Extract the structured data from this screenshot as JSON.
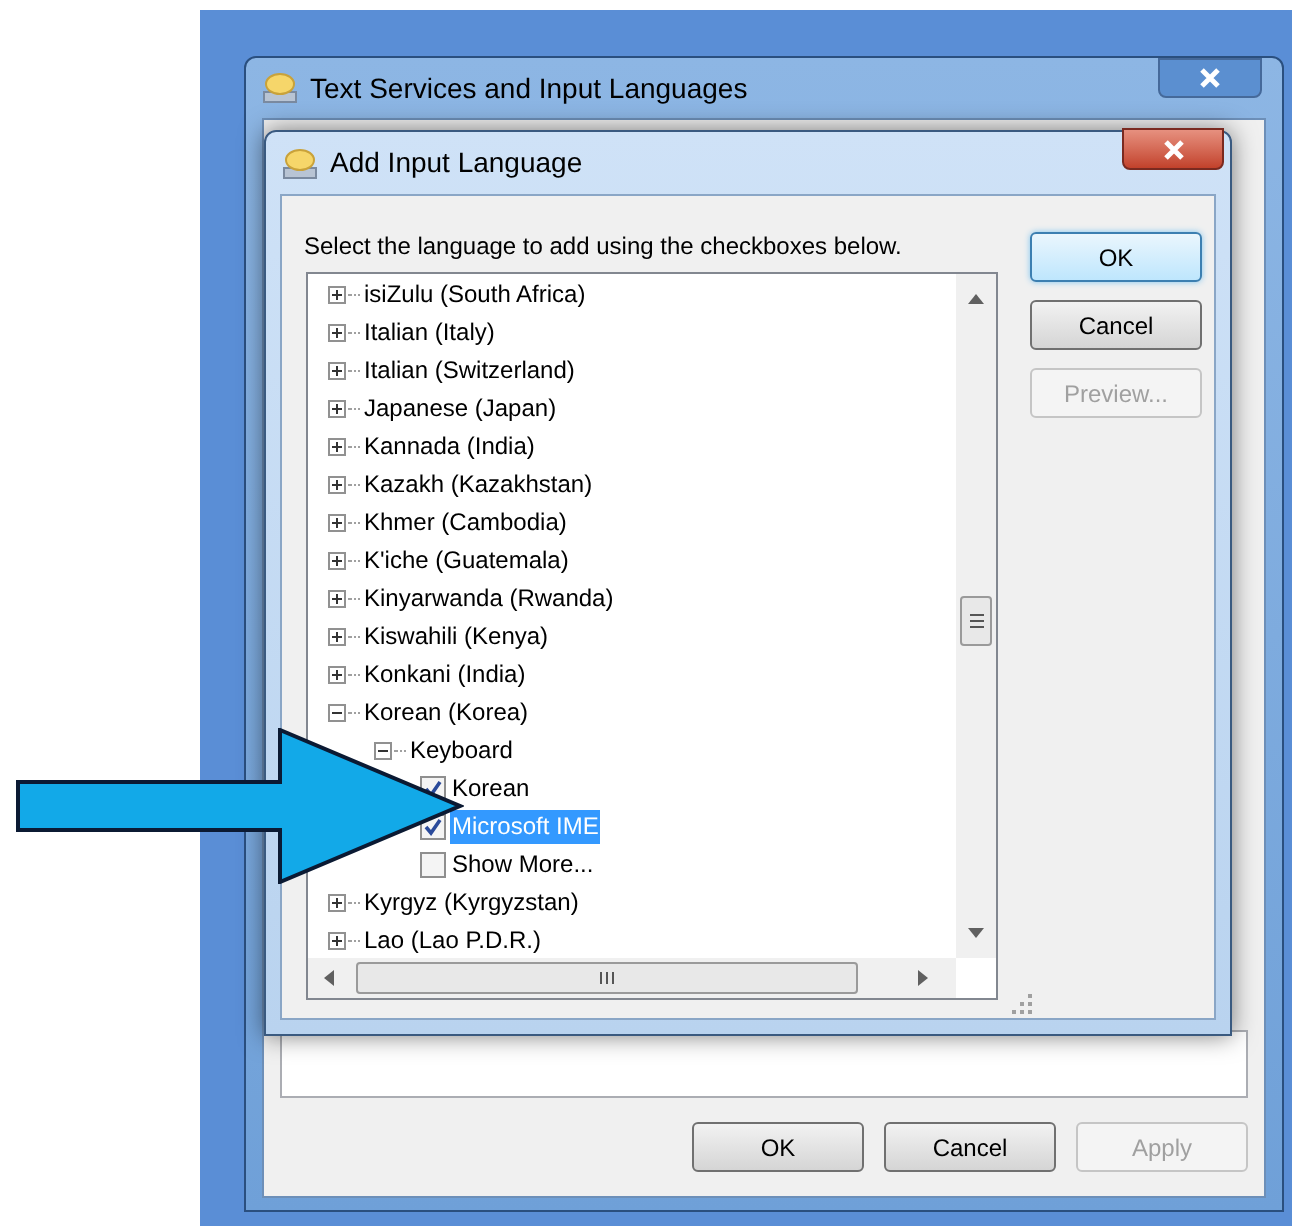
{
  "background_window": {
    "title": "Text Services and Input Languages",
    "buttons": [
      {
        "label": "OK",
        "disabled": false
      },
      {
        "label": "Cancel",
        "disabled": false
      },
      {
        "label": "Apply",
        "disabled": true
      }
    ]
  },
  "dialog": {
    "title": "Add Input Language",
    "instruction": "Select the language to add using the checkboxes below.",
    "tree": [
      {
        "label": "isiZulu (South Africa)",
        "expanded": false,
        "selected": false
      },
      {
        "label": "Italian (Italy)",
        "expanded": false,
        "selected": false
      },
      {
        "label": "Italian (Switzerland)",
        "expanded": false,
        "selected": false
      },
      {
        "label": "Japanese (Japan)",
        "expanded": false,
        "selected": false
      },
      {
        "label": "Kannada (India)",
        "expanded": false,
        "selected": false
      },
      {
        "label": "Kazakh (Kazakhstan)",
        "expanded": false,
        "selected": false
      },
      {
        "label": "Khmer (Cambodia)",
        "expanded": false,
        "selected": false
      },
      {
        "label": "K'iche (Guatemala)",
        "expanded": false,
        "selected": false
      },
      {
        "label": "Kinyarwanda (Rwanda)",
        "expanded": false,
        "selected": false
      },
      {
        "label": "Kiswahili (Kenya)",
        "expanded": false,
        "selected": false
      },
      {
        "label": "Konkani (India)",
        "expanded": false,
        "selected": false
      },
      {
        "label": "Korean (Korea)",
        "expanded": true,
        "selected": false,
        "children": [
          {
            "label": "Keyboard",
            "expanded": true,
            "selected": false,
            "children": [
              {
                "label": "Korean",
                "checked": true,
                "selected": false
              },
              {
                "label": "Microsoft IME",
                "checked": true,
                "selected": true
              },
              {
                "label": "Show More...",
                "checked": false,
                "selected": false
              }
            ]
          }
        ]
      },
      {
        "label": "Kyrgyz (Kyrgyzstan)",
        "expanded": false,
        "selected": false
      },
      {
        "label": "Lao (Lao P.D.R.)",
        "expanded": false,
        "selected": false
      }
    ],
    "buttons": [
      {
        "label": "OK",
        "default": true,
        "disabled": false
      },
      {
        "label": "Cancel",
        "default": false,
        "disabled": false
      },
      {
        "label": "Preview...",
        "default": false,
        "disabled": true
      }
    ]
  }
}
